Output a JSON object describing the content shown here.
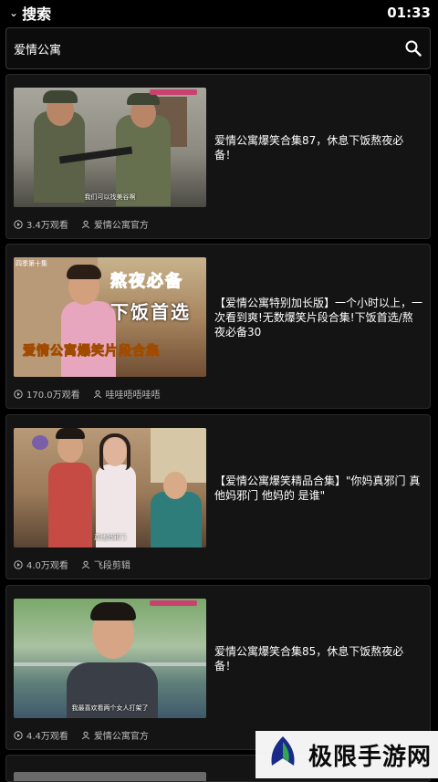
{
  "header": {
    "title": "搜索",
    "time": "01:33"
  },
  "search": {
    "query": "爱情公寓"
  },
  "results": [
    {
      "title": "爱情公寓爆笑合集87，休息下饭熬夜必备！",
      "views": "3.4万观看",
      "author": "爱情公寓官方",
      "subtitle": "我们可以找美谷啊"
    },
    {
      "title": "【爱情公寓特别加长版】一个小时以上，一次看到爽!无数爆笑片段合集!下饭首选/熬夜必备30",
      "views": "170.0万观看",
      "author": "哇哇唔唔哇唔",
      "overlay_top": "熬夜必备",
      "overlay_mid": "下饭首选",
      "overlay_bottom": "爱情公寓爆笑片段合集",
      "corner": "四季第十集"
    },
    {
      "title": "【爱情公寓爆笑精品合集】\"你妈真邪门 真他妈邪门 他妈的 是谁\"",
      "views": "4.0万观看",
      "author": "飞段剪辑",
      "subtitle": "真他妈邪门"
    },
    {
      "title": "爱情公寓爆笑合集85，休息下饭熬夜必备！",
      "views": "4.4万观看",
      "author": "爱情公寓官方",
      "subtitle": "我最喜欢看两个女人打架了"
    }
  ],
  "watermark": {
    "text": "极限手游网"
  }
}
